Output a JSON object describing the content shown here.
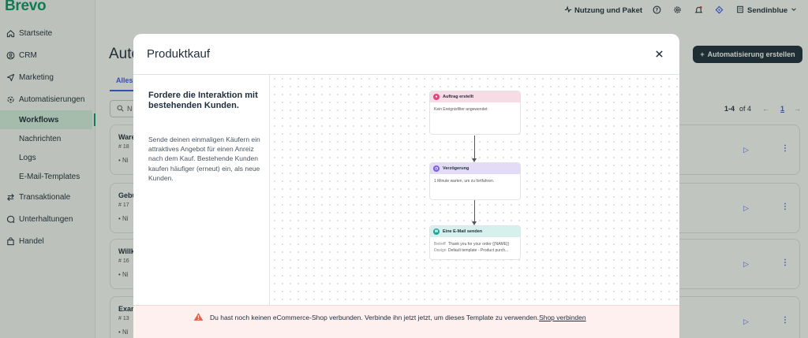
{
  "app": {
    "brand": "Brevo"
  },
  "sidebar": {
    "items": [
      {
        "label": "Startseite",
        "icon": "home-icon"
      },
      {
        "label": "CRM",
        "icon": "contacts-icon"
      },
      {
        "label": "Marketing",
        "icon": "send-icon"
      },
      {
        "label": "Automatisierungen",
        "icon": "automation-icon"
      },
      {
        "label": "Workflows",
        "sub": true,
        "active": true
      },
      {
        "label": "Nachrichten",
        "sub": true
      },
      {
        "label": "Logs",
        "sub": true
      },
      {
        "label": "E-Mail-Templates",
        "sub": true
      },
      {
        "label": "Transaktionale",
        "icon": "transfer-icon"
      },
      {
        "label": "Unterhaltungen",
        "icon": "chat-icon"
      },
      {
        "label": "Handel",
        "icon": "shop-icon"
      }
    ]
  },
  "topbar": {
    "usage_label": "Nutzung und Paket",
    "account_name": "Sendinblue"
  },
  "background": {
    "page_title": "Auto",
    "tab_label": "Alles",
    "search_placeholder": "N",
    "create_button": "Automatisierung erstellen",
    "pagination": {
      "range": "1-4",
      "of_label": "of 4",
      "current": "1"
    },
    "cards": [
      {
        "name": "Ware",
        "id": "18",
        "status": "Ni"
      },
      {
        "name": "Gebu",
        "id": "17",
        "status": "Ni"
      },
      {
        "name": "Willk",
        "id": "16",
        "status": "Ni"
      },
      {
        "name": "Exan",
        "id": "13",
        "status": "Ni"
      }
    ]
  },
  "modal": {
    "title": "Produktkauf",
    "heading": "Fordere die Interaktion mit bestehenden Kunden.",
    "description": "Sende deinen einmaligen Käufern ein attraktives Angebot für einen Anreiz nach dem Kauf. Bestehende Kunden kaufen häufiger (erneut) ein, als neue Kunden.",
    "flow": {
      "trigger": {
        "title": "Auftrag erstellt",
        "body": "Kein Ereignisfilter angewendet",
        "color": "#f7dce6",
        "icon_color": "#e0457b"
      },
      "delay": {
        "title": "Verzögerung",
        "body": "1 Minute warten, um zu fortfahren.",
        "color": "#e4dcf7",
        "icon_color": "#7b5ce0"
      },
      "email": {
        "title": "Eine E-Mail senden",
        "subject_key": "Betreff",
        "subject_value": "Thank you for your order {{NAME}}",
        "design_key": "Design",
        "design_value": "Default template - Product purch...",
        "color": "#d6f0ee",
        "icon_color": "#1fa39a"
      }
    },
    "warning": {
      "text": "Du hast noch keinen eCommerce-Shop verbunden. Verbinde ihn jetzt jetzt, um dieses Template zu verwenden.",
      "link": "Shop verbinden"
    }
  }
}
